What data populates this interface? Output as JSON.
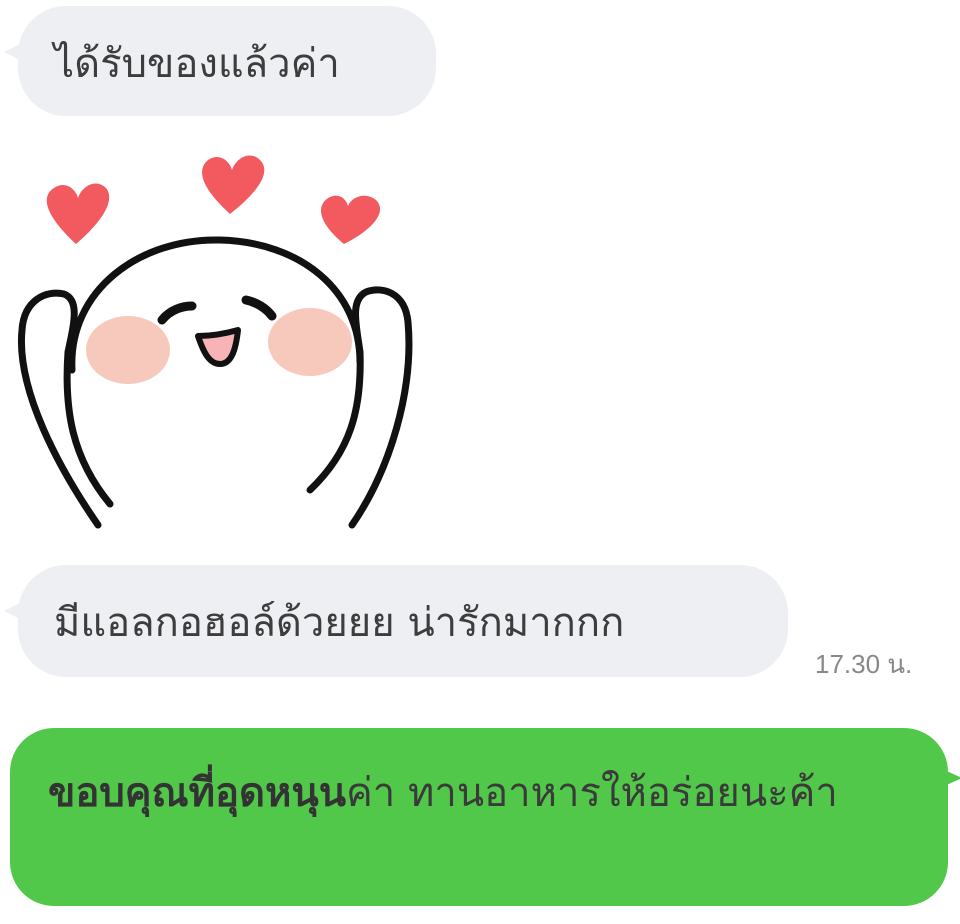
{
  "messages": {
    "received_1": {
      "text": "ได้รับของแล้วค่า"
    },
    "sticker": {
      "icon": "happy-face-hearts-sticker-icon",
      "heart_color": "#f25a5f",
      "blush_color": "#f4b7a6"
    },
    "received_2": {
      "text": "มีแอลกอฮอล์ด้วยยย น่ารักมากกก",
      "time": "17.30 น."
    },
    "sent_1": {
      "text_bold": "ขอบคุณที่อุดหนุน",
      "text_rest": "ค่า ทานอาหารให้อร่อยนะค้า"
    }
  },
  "colors": {
    "incoming_bubble": "#eeeff3",
    "outgoing_bubble": "#52c84a",
    "background": "#ffffff"
  }
}
